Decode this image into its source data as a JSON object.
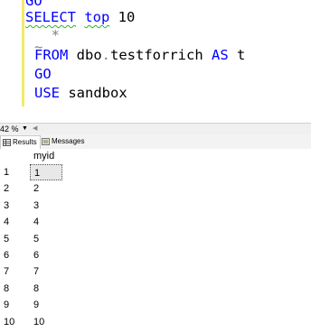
{
  "editor": {
    "lines": [
      {
        "parts": [
          {
            "text": "GO",
            "cls": "kw"
          }
        ]
      },
      {
        "parts": [
          {
            "text": "SELECT",
            "cls": "kw squig"
          },
          {
            "text": " ",
            "cls": "id"
          },
          {
            "text": "top",
            "cls": "kw squig"
          },
          {
            "text": " 10",
            "cls": "id"
          }
        ]
      },
      {
        "parts": [
          {
            "text": "  *",
            "cls": "sym"
          }
        ]
      },
      {
        "parts": [
          {
            "text": "~",
            "cls": "sym"
          }
        ]
      },
      {
        "parts": [
          {
            "text": "FROM",
            "cls": "kw"
          },
          {
            "text": " dbo",
            "cls": "id"
          },
          {
            "text": ".",
            "cls": "sym"
          },
          {
            "text": "testforrich ",
            "cls": "id"
          },
          {
            "text": "AS",
            "cls": "kw"
          },
          {
            "text": " t",
            "cls": "id"
          }
        ]
      },
      {
        "parts": [
          {
            "text": "GO",
            "cls": "kw"
          }
        ]
      },
      {
        "parts": [
          {
            "text": "USE",
            "cls": "kw"
          },
          {
            "text": " sandbox",
            "cls": "id"
          }
        ]
      }
    ]
  },
  "statusbar": {
    "zoom": "42 %"
  },
  "tabs": {
    "results_label": "Results",
    "messages_label": "Messages"
  },
  "results": {
    "column_header": "myid",
    "rows": [
      {
        "num": "1",
        "myid": "1"
      },
      {
        "num": "2",
        "myid": "2"
      },
      {
        "num": "3",
        "myid": "3"
      },
      {
        "num": "4",
        "myid": "4"
      },
      {
        "num": "5",
        "myid": "5"
      },
      {
        "num": "6",
        "myid": "6"
      },
      {
        "num": "7",
        "myid": "7"
      },
      {
        "num": "8",
        "myid": "8"
      },
      {
        "num": "9",
        "myid": "9"
      },
      {
        "num": "10",
        "myid": "10"
      }
    ]
  }
}
